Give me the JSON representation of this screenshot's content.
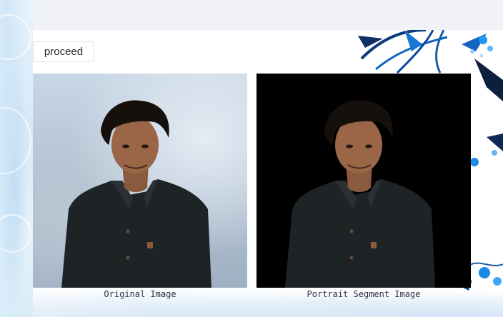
{
  "actions": {
    "proceed_label": "proceed"
  },
  "images": {
    "original_caption": "Original Image",
    "segment_caption": "Portrait Segment Image"
  },
  "colors": {
    "topbar": "#f0f2f6",
    "segment_background": "#000000",
    "accent_floral": "#1565c0"
  }
}
